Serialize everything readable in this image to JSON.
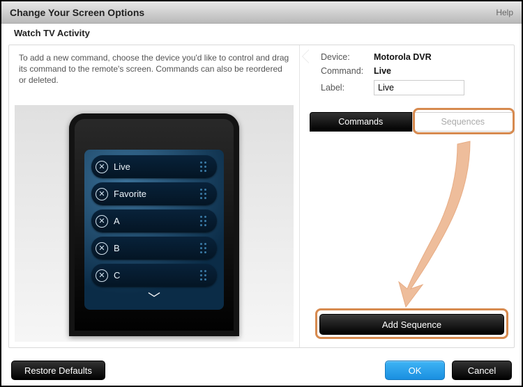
{
  "titlebar": {
    "title": "Change Your Screen Options",
    "help": "Help"
  },
  "subtitle": "Watch TV Activity",
  "instructions": "To add a new command, choose the device you'd like to control and drag its command to the remote's screen. Commands can also be reordered or deleted.",
  "remote": {
    "items": [
      "Live",
      "Favorite",
      "A",
      "B",
      "C"
    ]
  },
  "props": {
    "device_label": "Device:",
    "device_value": "Motorola DVR",
    "command_label": "Command:",
    "command_value": "Live",
    "label_label": "Label:",
    "label_value": "Live"
  },
  "tabs": {
    "commands": "Commands",
    "sequences": "Sequences"
  },
  "add_sequence": "Add Sequence",
  "buttons": {
    "restore": "Restore Defaults",
    "ok": "OK",
    "cancel": "Cancel"
  },
  "highlight_color": "#d78a4f"
}
